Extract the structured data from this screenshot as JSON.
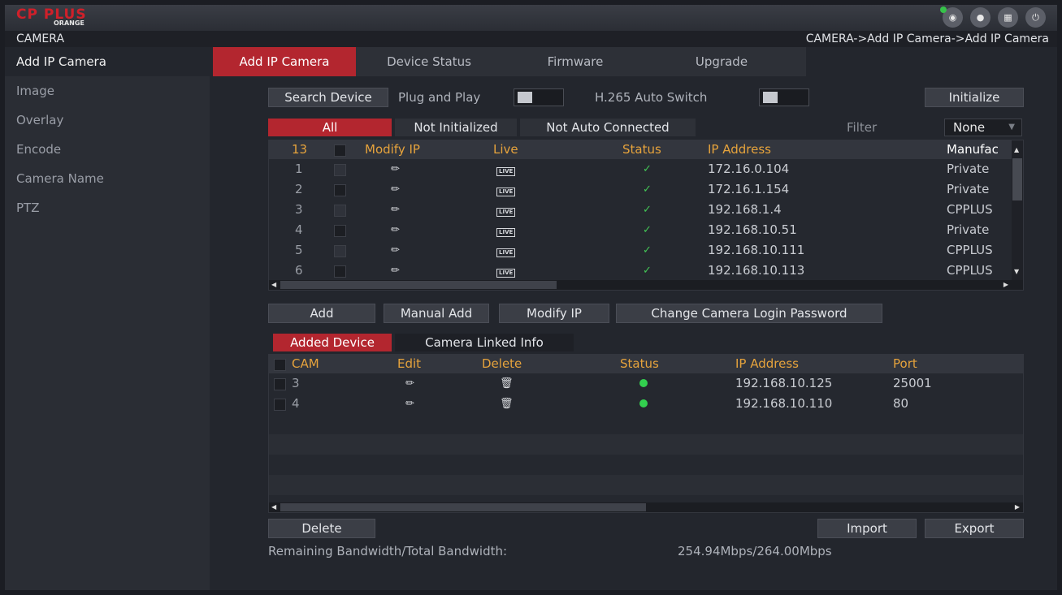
{
  "header": {
    "logo_text": "CP PLUS",
    "logo_sub": "ORANGE",
    "section": "CAMERA",
    "breadcrumb": "CAMERA->Add IP Camera->Add IP Camera",
    "icons": [
      "eye-icon",
      "user-icon",
      "grid-icon",
      "power-icon"
    ]
  },
  "sidebar": {
    "items": [
      {
        "label": "Add IP Camera"
      },
      {
        "label": "Image"
      },
      {
        "label": "Overlay"
      },
      {
        "label": "Encode"
      },
      {
        "label": "Camera Name"
      },
      {
        "label": "PTZ"
      }
    ]
  },
  "tabs": [
    {
      "label": "Add IP Camera"
    },
    {
      "label": "Device Status"
    },
    {
      "label": "Firmware"
    },
    {
      "label": "Upgrade"
    }
  ],
  "toolbar": {
    "search_device": "Search Device",
    "plug_and_play": "Plug and Play",
    "h265_auto_switch": "H.265 Auto Switch",
    "initialize": "Initialize"
  },
  "filter_tabs": {
    "all": "All",
    "not_initialized": "Not Initialized",
    "not_auto_connected": "Not Auto Connected",
    "filter_label": "Filter",
    "filter_value": "None"
  },
  "search_table": {
    "count": "13",
    "columns": [
      "Modify IP",
      "Live",
      "Status",
      "IP Address",
      "Manufac"
    ],
    "live_label": "LIVE",
    "rows": [
      {
        "no": "1",
        "ip": "172.16.0.104",
        "manufacturer": "Private"
      },
      {
        "no": "2",
        "ip": "172.16.1.154",
        "manufacturer": "Private"
      },
      {
        "no": "3",
        "ip": "192.168.1.4",
        "manufacturer": "CPPLUS"
      },
      {
        "no": "4",
        "ip": "192.168.10.51",
        "manufacturer": "Private"
      },
      {
        "no": "5",
        "ip": "192.168.10.111",
        "manufacturer": "CPPLUS"
      },
      {
        "no": "6",
        "ip": "192.168.10.113",
        "manufacturer": "CPPLUS"
      }
    ]
  },
  "actions": {
    "add": "Add",
    "manual_add": "Manual Add",
    "modify_ip": "Modify IP",
    "change_password": "Change Camera Login Password"
  },
  "added_tabs": {
    "added_device": "Added Device",
    "camera_linked_info": "Camera Linked Info"
  },
  "added_table": {
    "columns": [
      "CAM",
      "Edit",
      "Delete",
      "Status",
      "IP Address",
      "Port"
    ],
    "rows": [
      {
        "cam": "3",
        "ip": "192.168.10.125",
        "port": "25001"
      },
      {
        "cam": "4",
        "ip": "192.168.10.110",
        "port": "80"
      }
    ]
  },
  "bottom": {
    "delete": "Delete",
    "import": "Import",
    "export": "Export",
    "bandwidth_label": "Remaining Bandwidth/Total Bandwidth:",
    "bandwidth_value": "254.94Mbps/264.00Mbps"
  }
}
